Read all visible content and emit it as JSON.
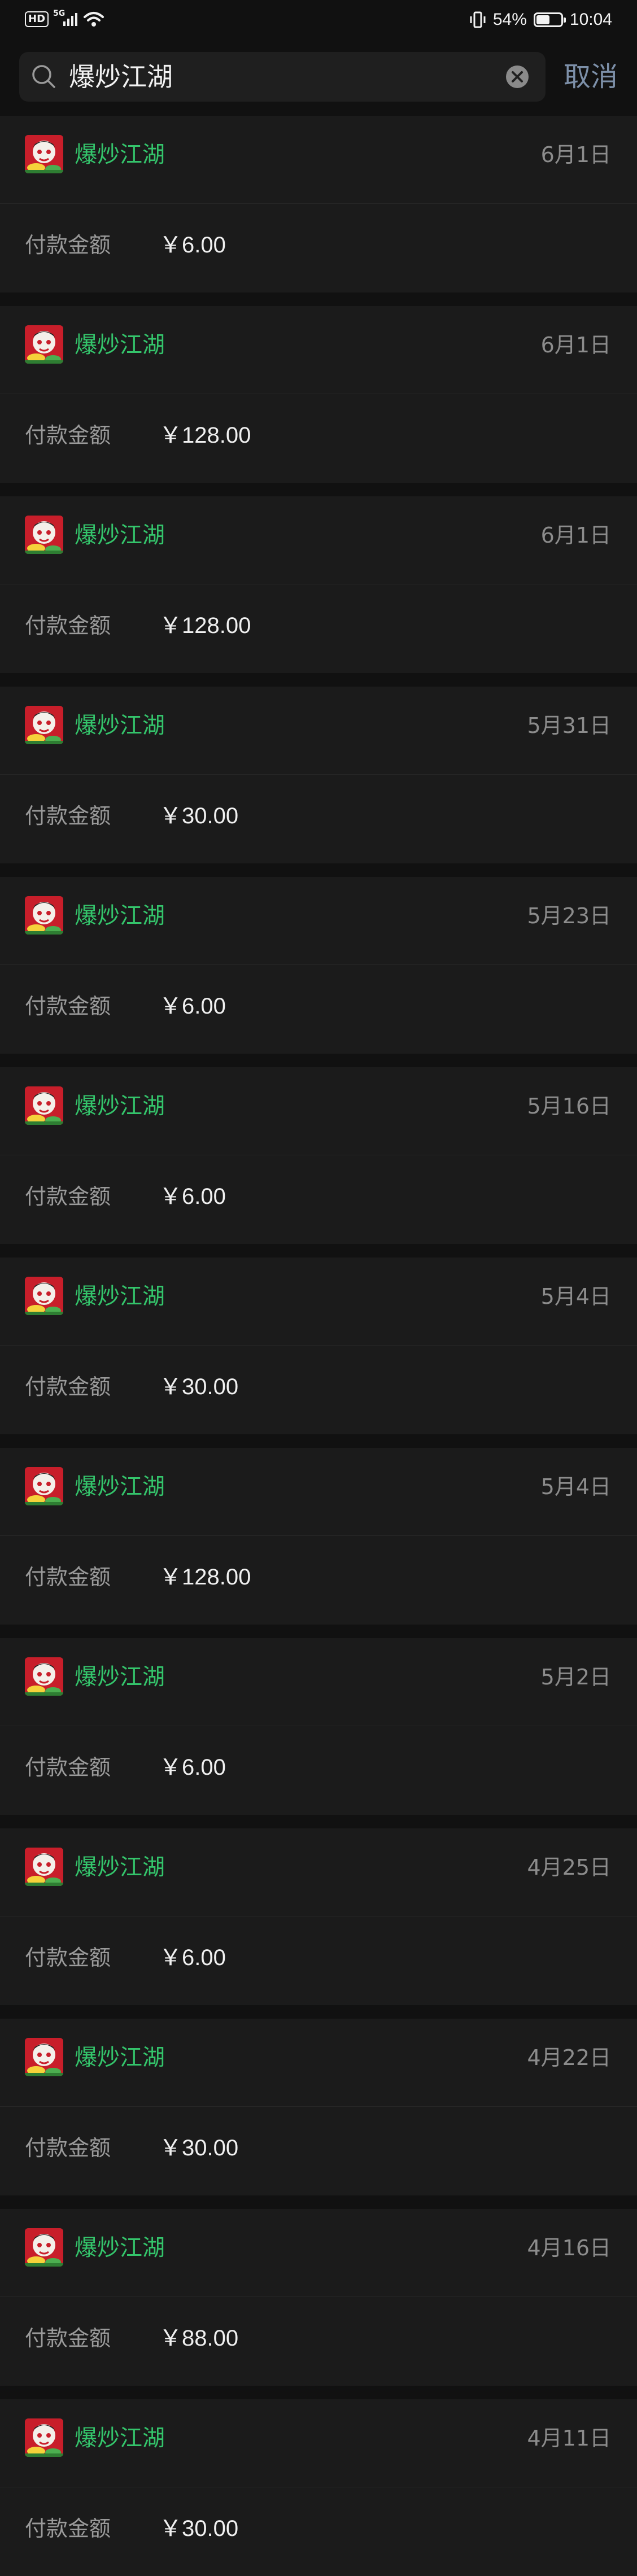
{
  "status_bar": {
    "hd_badge": "HD",
    "network_badge": "5G",
    "battery_text": "54%",
    "battery_level": 0.54,
    "time": "10:04"
  },
  "search": {
    "query": "爆炒江湖",
    "cancel_label": "取消"
  },
  "records": [
    {
      "merchant": "爆炒江湖",
      "date": "6月1日",
      "amount_label": "付款金额",
      "amount": "￥6.00"
    },
    {
      "merchant": "爆炒江湖",
      "date": "6月1日",
      "amount_label": "付款金额",
      "amount": "￥128.00"
    },
    {
      "merchant": "爆炒江湖",
      "date": "6月1日",
      "amount_label": "付款金额",
      "amount": "￥128.00"
    },
    {
      "merchant": "爆炒江湖",
      "date": "5月31日",
      "amount_label": "付款金额",
      "amount": "￥30.00"
    },
    {
      "merchant": "爆炒江湖",
      "date": "5月23日",
      "amount_label": "付款金额",
      "amount": "￥6.00"
    },
    {
      "merchant": "爆炒江湖",
      "date": "5月16日",
      "amount_label": "付款金额",
      "amount": "￥6.00"
    },
    {
      "merchant": "爆炒江湖",
      "date": "5月4日",
      "amount_label": "付款金额",
      "amount": "￥30.00"
    },
    {
      "merchant": "爆炒江湖",
      "date": "5月4日",
      "amount_label": "付款金额",
      "amount": "￥128.00"
    },
    {
      "merchant": "爆炒江湖",
      "date": "5月2日",
      "amount_label": "付款金额",
      "amount": "￥6.00"
    },
    {
      "merchant": "爆炒江湖",
      "date": "4月25日",
      "amount_label": "付款金额",
      "amount": "￥6.00"
    },
    {
      "merchant": "爆炒江湖",
      "date": "4月22日",
      "amount_label": "付款金额",
      "amount": "￥30.00"
    },
    {
      "merchant": "爆炒江湖",
      "date": "4月16日",
      "amount_label": "付款金额",
      "amount": "￥88.00"
    },
    {
      "merchant": "爆炒江湖",
      "date": "4月11日",
      "amount_label": "付款金额",
      "amount": "￥30.00"
    }
  ],
  "colors": {
    "background": "#111111",
    "card": "#1b1b1b",
    "merchant_green": "#34c46b",
    "cancel_blue": "#7d90a9"
  },
  "icons": {
    "search": "search-icon",
    "clear": "clear-icon",
    "app": "app-icon",
    "vibrate": "vibrate-icon",
    "wifi": "wifi-icon",
    "battery": "battery-icon"
  }
}
